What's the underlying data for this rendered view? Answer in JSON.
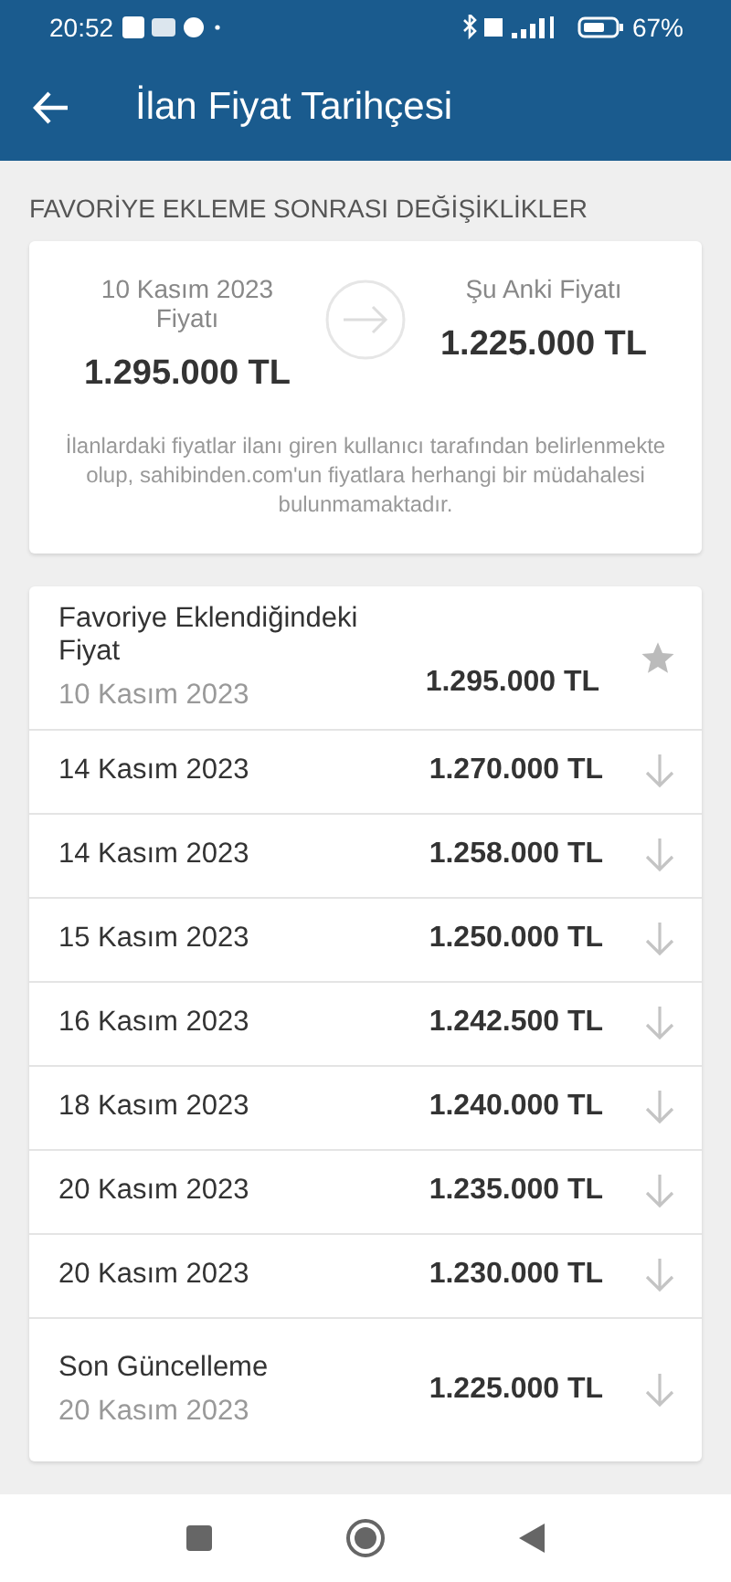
{
  "status_bar": {
    "time": "20:52",
    "battery": "67%"
  },
  "app_bar": {
    "title": "İlan Fiyat Tarihçesi"
  },
  "section_title": "FAVORİYE EKLEME SONRASI DEĞİŞİKLİKLER",
  "summary": {
    "from_label": "10 Kasım 2023 Fiyatı",
    "from_price": "1.295.000 TL",
    "to_label": "Şu Anki Fiyatı",
    "to_price": "1.225.000 TL",
    "note": "İlanlardaki fiyatlar ilanı giren kullanıcı tarafından belirlenmekte olup, sahibinden.com'un fiyatlara herhangi bir müdahalesi bulunmamaktadır."
  },
  "history": [
    {
      "kind": "favorite",
      "label": "Favoriye Eklendiğindeki Fiyat",
      "date": "10 Kasım 2023",
      "price": "1.295.000 TL"
    },
    {
      "kind": "change",
      "date": "14 Kasım 2023",
      "price": "1.270.000 TL"
    },
    {
      "kind": "change",
      "date": "14 Kasım 2023",
      "price": "1.258.000 TL"
    },
    {
      "kind": "change",
      "date": "15 Kasım 2023",
      "price": "1.250.000 TL"
    },
    {
      "kind": "change",
      "date": "16 Kasım 2023",
      "price": "1.242.500 TL"
    },
    {
      "kind": "change",
      "date": "18 Kasım 2023",
      "price": "1.240.000 TL"
    },
    {
      "kind": "change",
      "date": "20 Kasım 2023",
      "price": "1.235.000 TL"
    },
    {
      "kind": "change",
      "date": "20 Kasım 2023",
      "price": "1.230.000 TL"
    },
    {
      "kind": "latest",
      "label": "Son Güncelleme",
      "date": "20 Kasım 2023",
      "price": "1.225.000 TL"
    }
  ]
}
